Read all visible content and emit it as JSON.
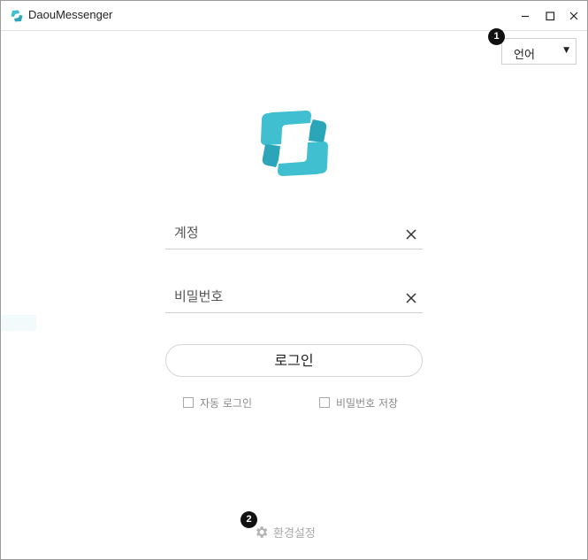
{
  "window": {
    "title": "DaouMessenger",
    "controls": {
      "minimize_icon": "minimize-icon",
      "maximize_icon": "maximize-icon",
      "close_icon": "close-icon"
    }
  },
  "annotations": {
    "badge_1": "1",
    "badge_2": "2"
  },
  "language": {
    "label": "언어",
    "arrow": "▼"
  },
  "login": {
    "account_placeholder": "계정",
    "account_value": "",
    "password_placeholder": "비밀번호",
    "password_value": "",
    "login_button": "로그인",
    "auto_login_label": "자동 로그인",
    "auto_login_checked": false,
    "save_password_label": "비밀번호 저장",
    "save_password_checked": false
  },
  "footer": {
    "settings_label": "환경설정",
    "settings_icon": "gear-icon"
  },
  "colors": {
    "brand": "#3fbfcf",
    "brand_dark": "#2aa6b8",
    "border": "#cfcfcf",
    "muted_text": "#8a8a8a"
  }
}
